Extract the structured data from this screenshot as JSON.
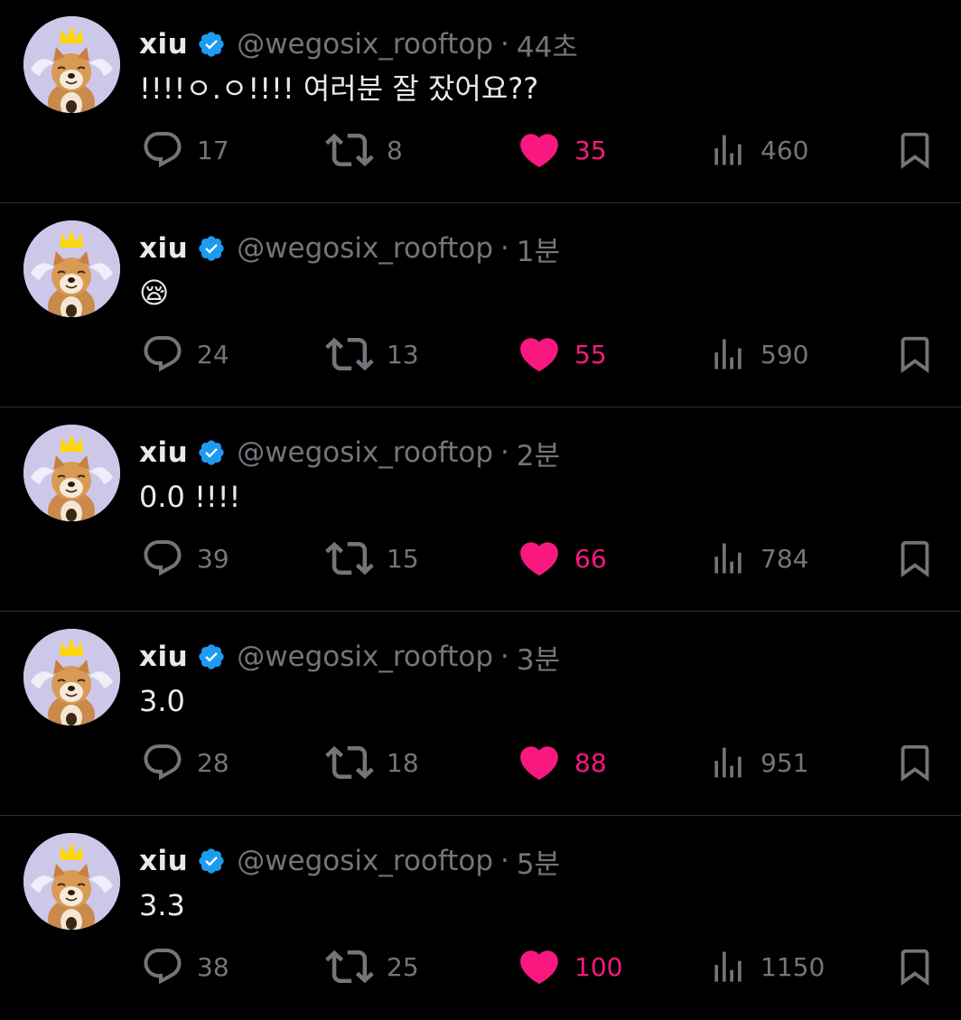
{
  "colors": {
    "background": "#000000",
    "text": "#e7e9ea",
    "muted": "#71767b",
    "like": "#f91880",
    "verified": "#1d9bf0",
    "divider": "#2f3336"
  },
  "icons": {
    "reply": "speech-bubble-icon",
    "retweet": "retweet-arrows-icon",
    "like": "heart-filled-icon",
    "views": "bar-chart-icon",
    "bookmark": "bookmark-icon",
    "verified": "verified-badge-icon"
  },
  "tweets": [
    {
      "name": "xiu",
      "handle": "@wegosix_rooftop",
      "separator": "·",
      "time": "44초",
      "text": "!!!!ㅇ.ㅇ!!!! 여러분 잘 잤어요??",
      "replies": "17",
      "retweets": "8",
      "likes": "35",
      "views": "460"
    },
    {
      "name": "xiu",
      "handle": "@wegosix_rooftop",
      "separator": "·",
      "time": "1분",
      "text": "😪",
      "replies": "24",
      "retweets": "13",
      "likes": "55",
      "views": "590"
    },
    {
      "name": "xiu",
      "handle": "@wegosix_rooftop",
      "separator": "·",
      "time": "2분",
      "text": "0.0 !!!!",
      "replies": "39",
      "retweets": "15",
      "likes": "66",
      "views": "784"
    },
    {
      "name": "xiu",
      "handle": "@wegosix_rooftop",
      "separator": "·",
      "time": "3분",
      "text": "3.0",
      "replies": "28",
      "retweets": "18",
      "likes": "88",
      "views": "951"
    },
    {
      "name": "xiu",
      "handle": "@wegosix_rooftop",
      "separator": "·",
      "time": "5분",
      "text": "3.3",
      "replies": "38",
      "retweets": "25",
      "likes": "100",
      "views": "1150"
    }
  ]
}
